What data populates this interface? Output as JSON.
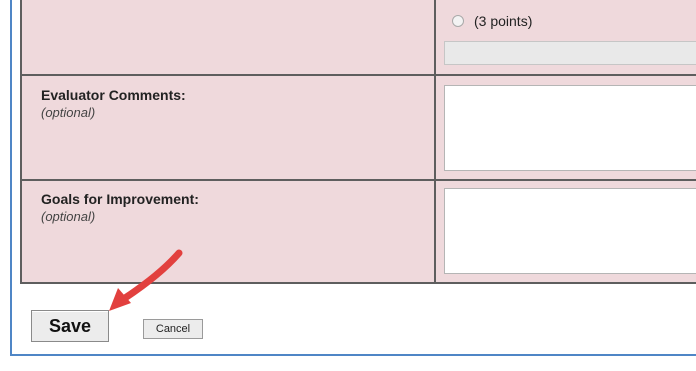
{
  "rating_option": {
    "label": "(3 points)",
    "selected": false
  },
  "evaluator_comments": {
    "label": "Evaluator Comments:",
    "hint": "(optional)",
    "value": ""
  },
  "goals_improvement": {
    "label": "Goals for Improvement:",
    "hint": "(optional)",
    "value": ""
  },
  "buttons": {
    "save_label": "Save",
    "cancel_label": "Cancel"
  },
  "colors": {
    "table_background": "#efd9dc",
    "frame_border": "#4f86c6",
    "annotation_arrow": "#e2403e"
  }
}
